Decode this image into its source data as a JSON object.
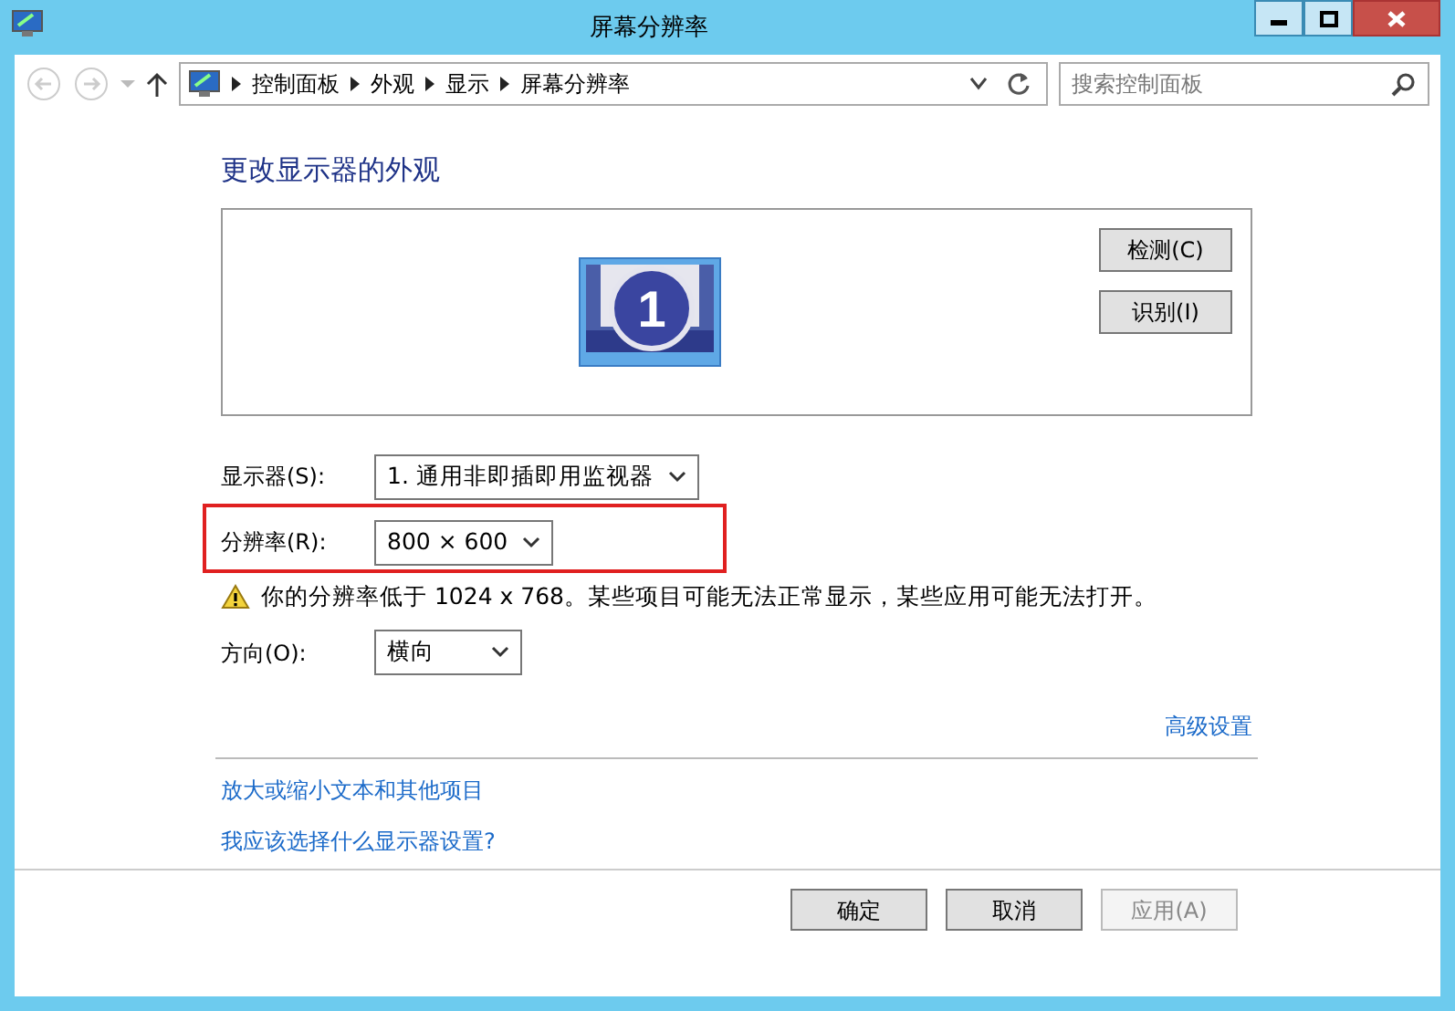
{
  "window": {
    "title": "屏幕分辨率"
  },
  "address_bar": {
    "crumbs": [
      "控制面板",
      "外观",
      "显示",
      "屏幕分辨率"
    ]
  },
  "search": {
    "placeholder": "搜索控制面板"
  },
  "heading": "更改显示器的外观",
  "monitor": {
    "number": "1"
  },
  "side_buttons": [
    "检测(C)",
    "识别(I)"
  ],
  "settings": [
    {
      "label": "显示器(S):",
      "value": "1. 通用非即插即用监视器",
      "highlighted": false
    },
    {
      "label": "分辨率(R):",
      "value": "800 × 600",
      "highlighted": true
    }
  ],
  "warning": "你的分辨率低于 1024 x 768。某些项目可能无法正常显示，某些应用可能无法打开。",
  "orientation": {
    "label": "方向(O):",
    "value": "横向"
  },
  "advanced_link": "高级设置",
  "links": [
    "放大或缩小文本和其他项目",
    "我应该选择什么显示器设置?"
  ],
  "buttons": [
    {
      "label": "确定",
      "disabled": false
    },
    {
      "label": "取消",
      "disabled": false
    },
    {
      "label": "应用(A)",
      "disabled": true
    }
  ]
}
